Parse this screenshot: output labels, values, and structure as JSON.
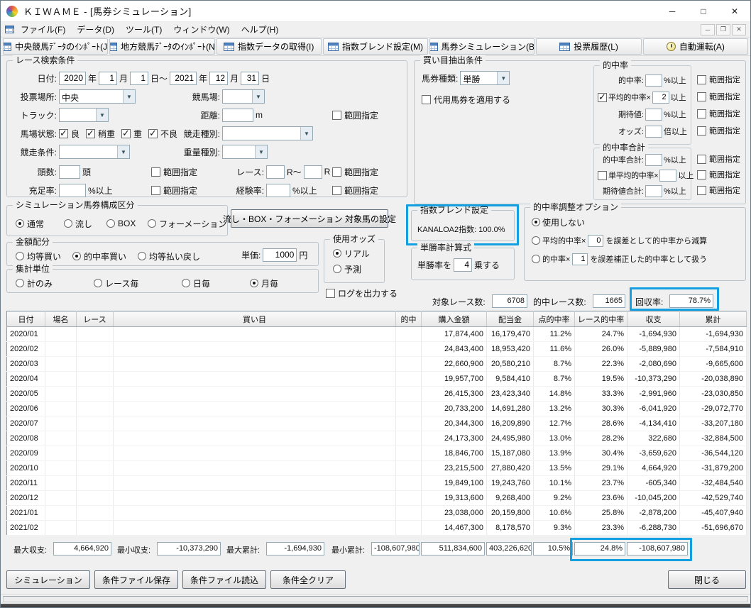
{
  "colors": {
    "highlight": "#13a0e0"
  },
  "icons": {
    "dropdown": "▼"
  },
  "labels": {
    "range": "範囲指定"
  },
  "window": {
    "title": "ＫＩＷＡＭＥ - [馬券シミュレーション]",
    "controls": {
      "minimize": "─",
      "maximize": "□",
      "close": "✕"
    },
    "mdi": {
      "minimize": "─",
      "restore": "❐",
      "close": "✕"
    }
  },
  "menu": {
    "items": [
      "ファイル(F)",
      "データ(D)",
      "ツール(T)",
      "ウィンドウ(W)",
      "ヘルプ(H)"
    ]
  },
  "toolbar": {
    "buttons": [
      {
        "label": "中央競馬ﾃﾞｰﾀのｲﾝﾎﾟｰﾄ(J)",
        "icon": "table"
      },
      {
        "label": "地方競馬ﾃﾞｰﾀのｲﾝﾎﾟｰﾄ(N)",
        "icon": "table"
      },
      {
        "label": "指数データの取得(I)",
        "icon": "table"
      },
      {
        "label": "指数ブレンド設定(M)",
        "icon": "table"
      },
      {
        "label": "馬券シミュレーション(B)",
        "icon": "table"
      },
      {
        "label": "投票履歴(L)",
        "icon": "table"
      },
      {
        "label": "自動運転(A)",
        "icon": "clock"
      }
    ]
  },
  "search": {
    "legend": "レース検索条件",
    "date": {
      "label": "日付:",
      "from_year": "2020",
      "from_month": "1",
      "from_day": "1",
      "to_year": "2021",
      "to_month": "12",
      "to_day": "31",
      "units": [
        "年",
        "月",
        "日～",
        "年",
        "月",
        "日"
      ]
    },
    "place": {
      "label": "投票場所:",
      "value": "中央"
    },
    "course": {
      "label": "競馬場:",
      "value": ""
    },
    "track": {
      "label": "トラック:",
      "value": ""
    },
    "distance": {
      "label": "距離:",
      "value": "",
      "unit": "m"
    },
    "surface": {
      "label": "馬場状態:",
      "options": [
        "良",
        "稍重",
        "重",
        "不良"
      ],
      "checked": [
        "良",
        "稍重",
        "重",
        "不良"
      ]
    },
    "race_type": {
      "label": "競走種別:",
      "value": ""
    },
    "race_cond": {
      "label": "競走条件:",
      "value": ""
    },
    "weight_type": {
      "label": "重量種別:",
      "value": ""
    },
    "heads": {
      "label": "頭数:",
      "value": "",
      "unit": "頭"
    },
    "race_no": {
      "label": "レース:",
      "value1": "",
      "unit1": "R～",
      "value2": "",
      "unit2": "R"
    },
    "fill_rate": {
      "label": "充足率:",
      "value": "",
      "unit": "%以上"
    },
    "exp_rate": {
      "label": "経験率:",
      "value": "",
      "unit": "%以上"
    }
  },
  "extract": {
    "legend": "買い目抽出条件",
    "bet_type": {
      "label": "馬券種類:",
      "value": "単勝"
    },
    "substitute_label": "代用馬券を適用する",
    "hit": {
      "legend": "的中率",
      "row1": {
        "label": "的中率:",
        "value": "",
        "unit": "%以上"
      },
      "row2": {
        "label": "平均的中率×",
        "value": "2",
        "unit": "以上",
        "checked": true
      },
      "row3": {
        "label": "期待値:",
        "value": "",
        "unit": "%以上"
      },
      "row4": {
        "label": "オッズ:",
        "value": "",
        "unit": "倍以上"
      }
    },
    "hit_total": {
      "legend": "的中率合計",
      "row1": {
        "label": "的中率合計:",
        "value": "",
        "unit": "%以上"
      },
      "row2": {
        "label": "単平均的中率×",
        "value": "",
        "unit": "以上",
        "checked": false
      },
      "row3": {
        "label": "期待値合計:",
        "value": "",
        "unit": "%以上"
      }
    }
  },
  "sim_type": {
    "legend": "シミュレーション馬券構成区分",
    "options": [
      "通常",
      "流し",
      "BOX",
      "フォーメーション"
    ],
    "selected": "通常"
  },
  "target_button": "流し・BOX・フォーメーション 対象馬の設定",
  "blend": {
    "legend": "指数ブレンド設定",
    "value": "KANALOA2指数: 100.0%"
  },
  "adjust": {
    "legend": "的中率調整オプション",
    "opt1": "使用しない",
    "opt2_pre": "平均的中率×",
    "opt2_value": "0",
    "opt2_post": "を誤差として的中率から減算",
    "opt3_pre": "的中率×",
    "opt3_value": "1",
    "opt3_post": "を誤差補正した的中率として扱う",
    "selected": "使用しない"
  },
  "amount": {
    "legend": "金額配分",
    "options": [
      "均等買い",
      "的中率買い",
      "均等払い戻し"
    ],
    "selected": "的中率買い",
    "unit_label": "単価:",
    "unit_value": "1000",
    "unit_suffix": "円"
  },
  "odds": {
    "legend": "使用オッズ",
    "options": [
      "リアル",
      "予測"
    ],
    "selected": "リアル"
  },
  "formula": {
    "legend": "単勝率計算式",
    "pre": "単勝率を",
    "value": "4",
    "post": "乗する"
  },
  "aggregate": {
    "legend": "集計単位",
    "options": [
      "計のみ",
      "レース毎",
      "日毎",
      "月毎"
    ],
    "selected": "月毎"
  },
  "log_label": "ログを出力する",
  "stats": {
    "target_label": "対象レース数:",
    "target_value": "6708",
    "hit_label": "的中レース数:",
    "hit_value": "1665",
    "recovery_label": "回収率:",
    "recovery_value": "78.7%"
  },
  "table": {
    "columns": [
      "日付",
      "場名",
      "レース",
      "買い目",
      "的中",
      "購入金額",
      "配当金",
      "点的中率",
      "レース的中率",
      "収支",
      "累計"
    ],
    "rows": [
      [
        "2020/01",
        "",
        "",
        "",
        "",
        "17,874,400",
        "16,179,470",
        "11.2%",
        "24.7%",
        "-1,694,930",
        "-1,694,930"
      ],
      [
        "2020/02",
        "",
        "",
        "",
        "",
        "24,843,400",
        "18,953,420",
        "11.6%",
        "26.0%",
        "-5,889,980",
        "-7,584,910"
      ],
      [
        "2020/03",
        "",
        "",
        "",
        "",
        "22,660,900",
        "20,580,210",
        "8.7%",
        "22.3%",
        "-2,080,690",
        "-9,665,600"
      ],
      [
        "2020/04",
        "",
        "",
        "",
        "",
        "19,957,700",
        "9,584,410",
        "8.7%",
        "19.5%",
        "-10,373,290",
        "-20,038,890"
      ],
      [
        "2020/05",
        "",
        "",
        "",
        "",
        "26,415,300",
        "23,423,340",
        "14.8%",
        "33.3%",
        "-2,991,960",
        "-23,030,850"
      ],
      [
        "2020/06",
        "",
        "",
        "",
        "",
        "20,733,200",
        "14,691,280",
        "13.2%",
        "30.3%",
        "-6,041,920",
        "-29,072,770"
      ],
      [
        "2020/07",
        "",
        "",
        "",
        "",
        "20,344,300",
        "16,209,890",
        "12.7%",
        "28.6%",
        "-4,134,410",
        "-33,207,180"
      ],
      [
        "2020/08",
        "",
        "",
        "",
        "",
        "24,173,300",
        "24,495,980",
        "13.0%",
        "28.2%",
        "322,680",
        "-32,884,500"
      ],
      [
        "2020/09",
        "",
        "",
        "",
        "",
        "18,846,700",
        "15,187,080",
        "13.9%",
        "30.4%",
        "-3,659,620",
        "-36,544,120"
      ],
      [
        "2020/10",
        "",
        "",
        "",
        "",
        "23,215,500",
        "27,880,420",
        "13.5%",
        "29.1%",
        "4,664,920",
        "-31,879,200"
      ],
      [
        "2020/11",
        "",
        "",
        "",
        "",
        "19,849,100",
        "19,243,760",
        "10.1%",
        "23.7%",
        "-605,340",
        "-32,484,540"
      ],
      [
        "2020/12",
        "",
        "",
        "",
        "",
        "19,313,600",
        "9,268,400",
        "9.2%",
        "23.6%",
        "-10,045,200",
        "-42,529,740"
      ],
      [
        "2021/01",
        "",
        "",
        "",
        "",
        "23,038,000",
        "20,159,800",
        "10.6%",
        "25.8%",
        "-2,878,200",
        "-45,407,940"
      ],
      [
        "2021/02",
        "",
        "",
        "",
        "",
        "14,467,300",
        "8,178,570",
        "9.3%",
        "23.3%",
        "-6,288,730",
        "-51,696,670"
      ]
    ]
  },
  "summary": {
    "max_balance_label": "最大収支:",
    "max_balance": "4,664,920",
    "min_balance_label": "最小収支:",
    "min_balance": "-10,373,290",
    "max_total_label": "最大累計:",
    "max_total": "-1,694,930",
    "min_total_label": "最小累計:",
    "min_total": "-108,607,980",
    "purchase_total": "511,834,600",
    "payout_total": "403,226,620",
    "point_hit_total": "10.5%",
    "race_hit_total": "24.8%",
    "balance_total": "-108,607,980"
  },
  "footer": {
    "buttons": [
      "シミュレーション",
      "条件ファイル保存",
      "条件ファイル読込",
      "条件全クリア"
    ],
    "close": "閉じる"
  }
}
